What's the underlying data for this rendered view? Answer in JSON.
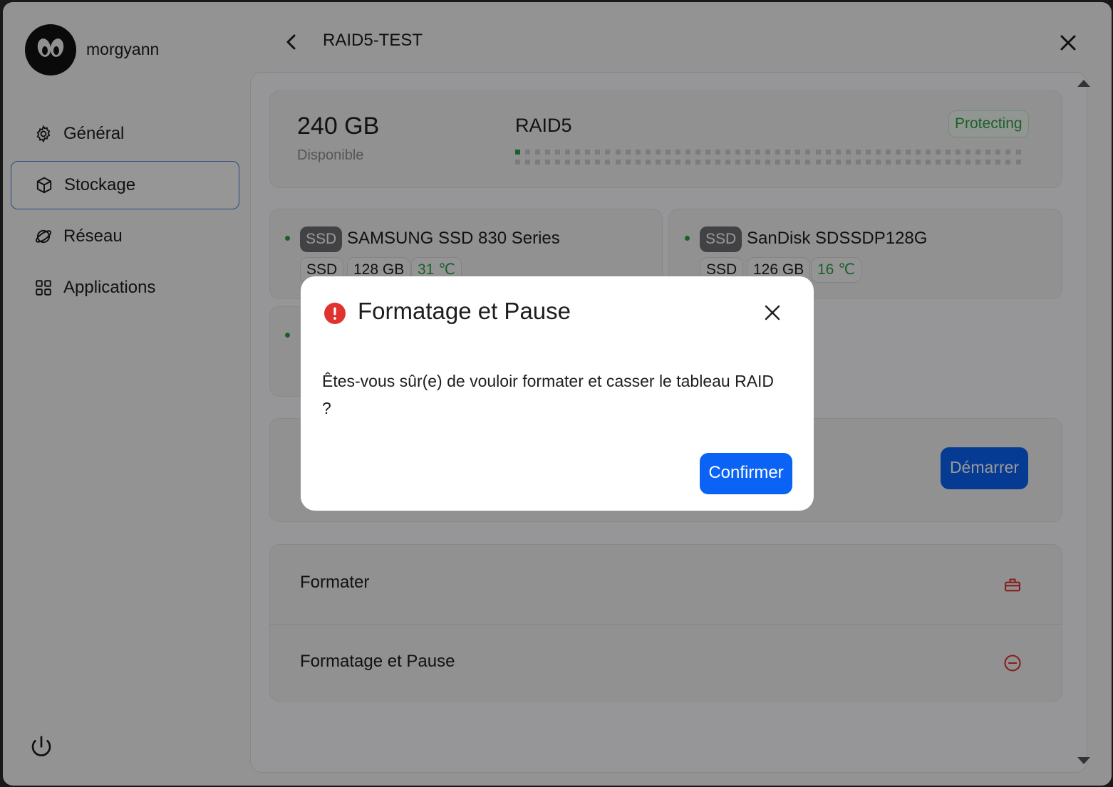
{
  "user": {
    "name": "morgyann"
  },
  "sidebar": {
    "items": [
      {
        "label": "Général",
        "icon": "gear-icon"
      },
      {
        "label": "Stockage",
        "icon": "box-icon",
        "active": true
      },
      {
        "label": "Réseau",
        "icon": "globe-icon"
      },
      {
        "label": "Applications",
        "icon": "grid-icon"
      }
    ],
    "power_icon": "power-icon"
  },
  "header": {
    "title": "RAID5-TEST"
  },
  "summary": {
    "capacity": "240 GB",
    "capacity_label": "Disponible",
    "raid_type": "RAID5",
    "status": "Protecting",
    "status_color": "#2ea043"
  },
  "disks": [
    {
      "badge": "SSD",
      "name": "SAMSUNG SSD 830 Series",
      "type": "SSD",
      "size": "128 GB",
      "temp": "31 ℃"
    },
    {
      "badge": "SSD",
      "name": "SanDisk SDSSDP128G",
      "type": "SSD",
      "size": "126 GB",
      "temp": "16 ℃"
    }
  ],
  "start_button": {
    "label": "Démarrer"
  },
  "actions": [
    {
      "label": "Formater",
      "icon": "eraser-icon"
    },
    {
      "label": "Formatage et Pause",
      "icon": "minus-circle-icon"
    }
  ],
  "modal": {
    "title": "Formatage et Pause",
    "icon": "alert-icon",
    "message": "Êtes-vous sûr(e) de vouloir formater et casser le tableau RAID ?",
    "confirm_label": "Confirmer"
  },
  "colors": {
    "accent": "#0a63f5",
    "danger": "#e0332f",
    "success": "#2ea043"
  }
}
